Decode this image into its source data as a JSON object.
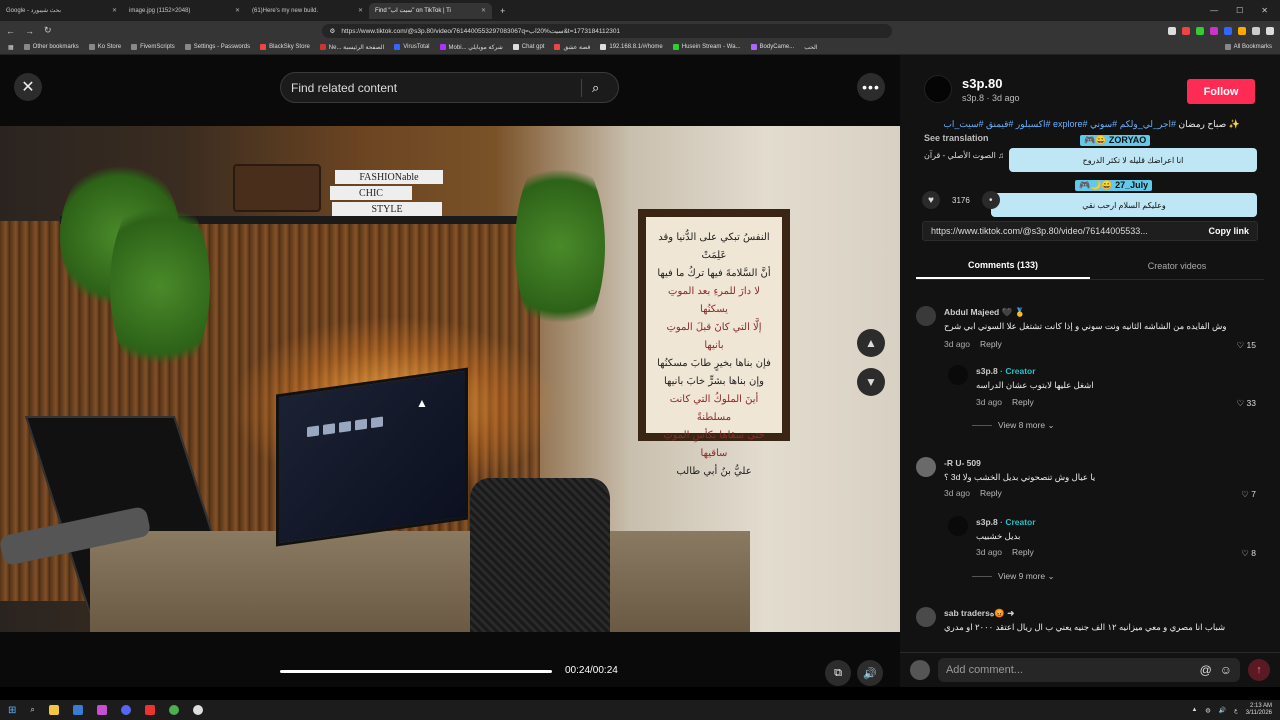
{
  "browser": {
    "tabs": [
      {
        "label": "Google - بحث شيبورد",
        "active": false
      },
      {
        "label": "image.jpg (1152×2048)",
        "active": false
      },
      {
        "label": "(61)Here's my new build.",
        "active": false
      },
      {
        "label": "Find \"سيت اب\" on TikTok | Ti",
        "active": true
      }
    ],
    "url": "https://www.tiktok.com/@s3p.80/video/7614400553297083067q=سيت%20اب&t=1773184112301",
    "bookmarks": [
      "Other bookmarks",
      "Ko Store",
      "FivemScripts",
      "Settings - Passwords",
      "BlackSky Store",
      "Ne... الصفحة الرئيسية",
      "VirusTotal",
      "Mobi... شركة موبايلي",
      "Chat gpt",
      "قصة عشق",
      "192.168.8.1/#/home",
      "Husein Stream - Wa...",
      "BodyCame...",
      "الحب"
    ],
    "all_bookmarks": "All Bookmarks"
  },
  "viewer": {
    "search_placeholder": "Find related content",
    "time": "00:24/00:24",
    "progress": 1.0,
    "frame_lines": [
      "النفسُ تبكي على الدُّنيا وقد عَلِمَتْ",
      "أنَّ السَّلامةَ فيها تركُ ما فيها",
      "لا دارَ للمرءِ بعد الموتِ يسكنُها",
      "إلَّا التي كانَ قبلَ الموتِ بانيها",
      "فإن بناها بخيرٍ طابَ مسكنُها",
      "وإن بناها بشرٍّ خابَ بانيها",
      "أينَ الملوكُ التي كانت مسلطنةً",
      "حتى سقاها بكأسِ الموتِ ساقيها",
      "عليُّ بنُ أبي طالب"
    ],
    "books": [
      "FASHIONable",
      "CHIC",
      "STYLE"
    ]
  },
  "panel": {
    "author": {
      "name": "s3p.80",
      "sub": "s3p.8 · 3d ago",
      "follow_label": "Follow"
    },
    "caption": {
      "tags": "#اجر_لي_ولكم #سوني #explore #اكسبلور #قيمنق #سيت_اب",
      "text": "✨ صباح رمضان"
    },
    "see_translation": "See translation",
    "sound": "♫ الصوت الأصلي - قرآن",
    "chat": [
      {
        "tag": "🎮😀 ZORYAO",
        "text": "انا اعراضك قليله لا تكثر الدروح"
      },
      {
        "tag": "🎮🌙😀 27_July",
        "text": "وعليكم السلام ارحب نقي"
      }
    ],
    "likes": "3176",
    "link": "https://www.tiktok.com/@s3p.80/video/76144005533...",
    "copy_link": "Copy link",
    "tabs": [
      "Comments (133)",
      "Creator videos"
    ],
    "comments": [
      {
        "name": "Abdul Majeed 🖤 🥇",
        "text": "وش الفايده من الشاشه الثانيه ونت سوني و إذا كانت تشتغل علا السوني ابي شرح",
        "ago": "3d ago",
        "reply": "Reply",
        "likes": "15"
      },
      {
        "name": "s3p.8",
        "creator": "· Creator",
        "text": "اشغل عليها لابتوب عشان الدراسه",
        "ago": "3d ago",
        "reply": "Reply",
        "likes": "33"
      },
      {
        "name": "-R U- 509",
        "text": "يا عيال وش تنصحوني بديل الخشب ولا 3d ؟",
        "ago": "3d ago",
        "reply": "Reply",
        "likes": "7"
      },
      {
        "name": "s3p.8",
        "creator": "· Creator",
        "text": "بديل خشبيب",
        "ago": "3d ago",
        "reply": "Reply",
        "likes": "8"
      },
      {
        "name": "sab tradersه😡 ➜",
        "text": "شباب انا مصري و معي ميزانيه ١٢ الف جنيه يعني ب ال ريال اعتقد ٢٠٠٠ او مدري صراحه ف ابي شيء حلو بشغل فورت و كول اوف ديوتي و روبلكس",
        "ago": "",
        "reply": "",
        "likes": ""
      }
    ],
    "view_more": [
      "View 8 more",
      "View 9 more"
    ],
    "add_comment_placeholder": "Add comment..."
  },
  "taskbar": {
    "time": "2:13 AM",
    "date": "3/11/2026",
    "lang": "ع"
  }
}
